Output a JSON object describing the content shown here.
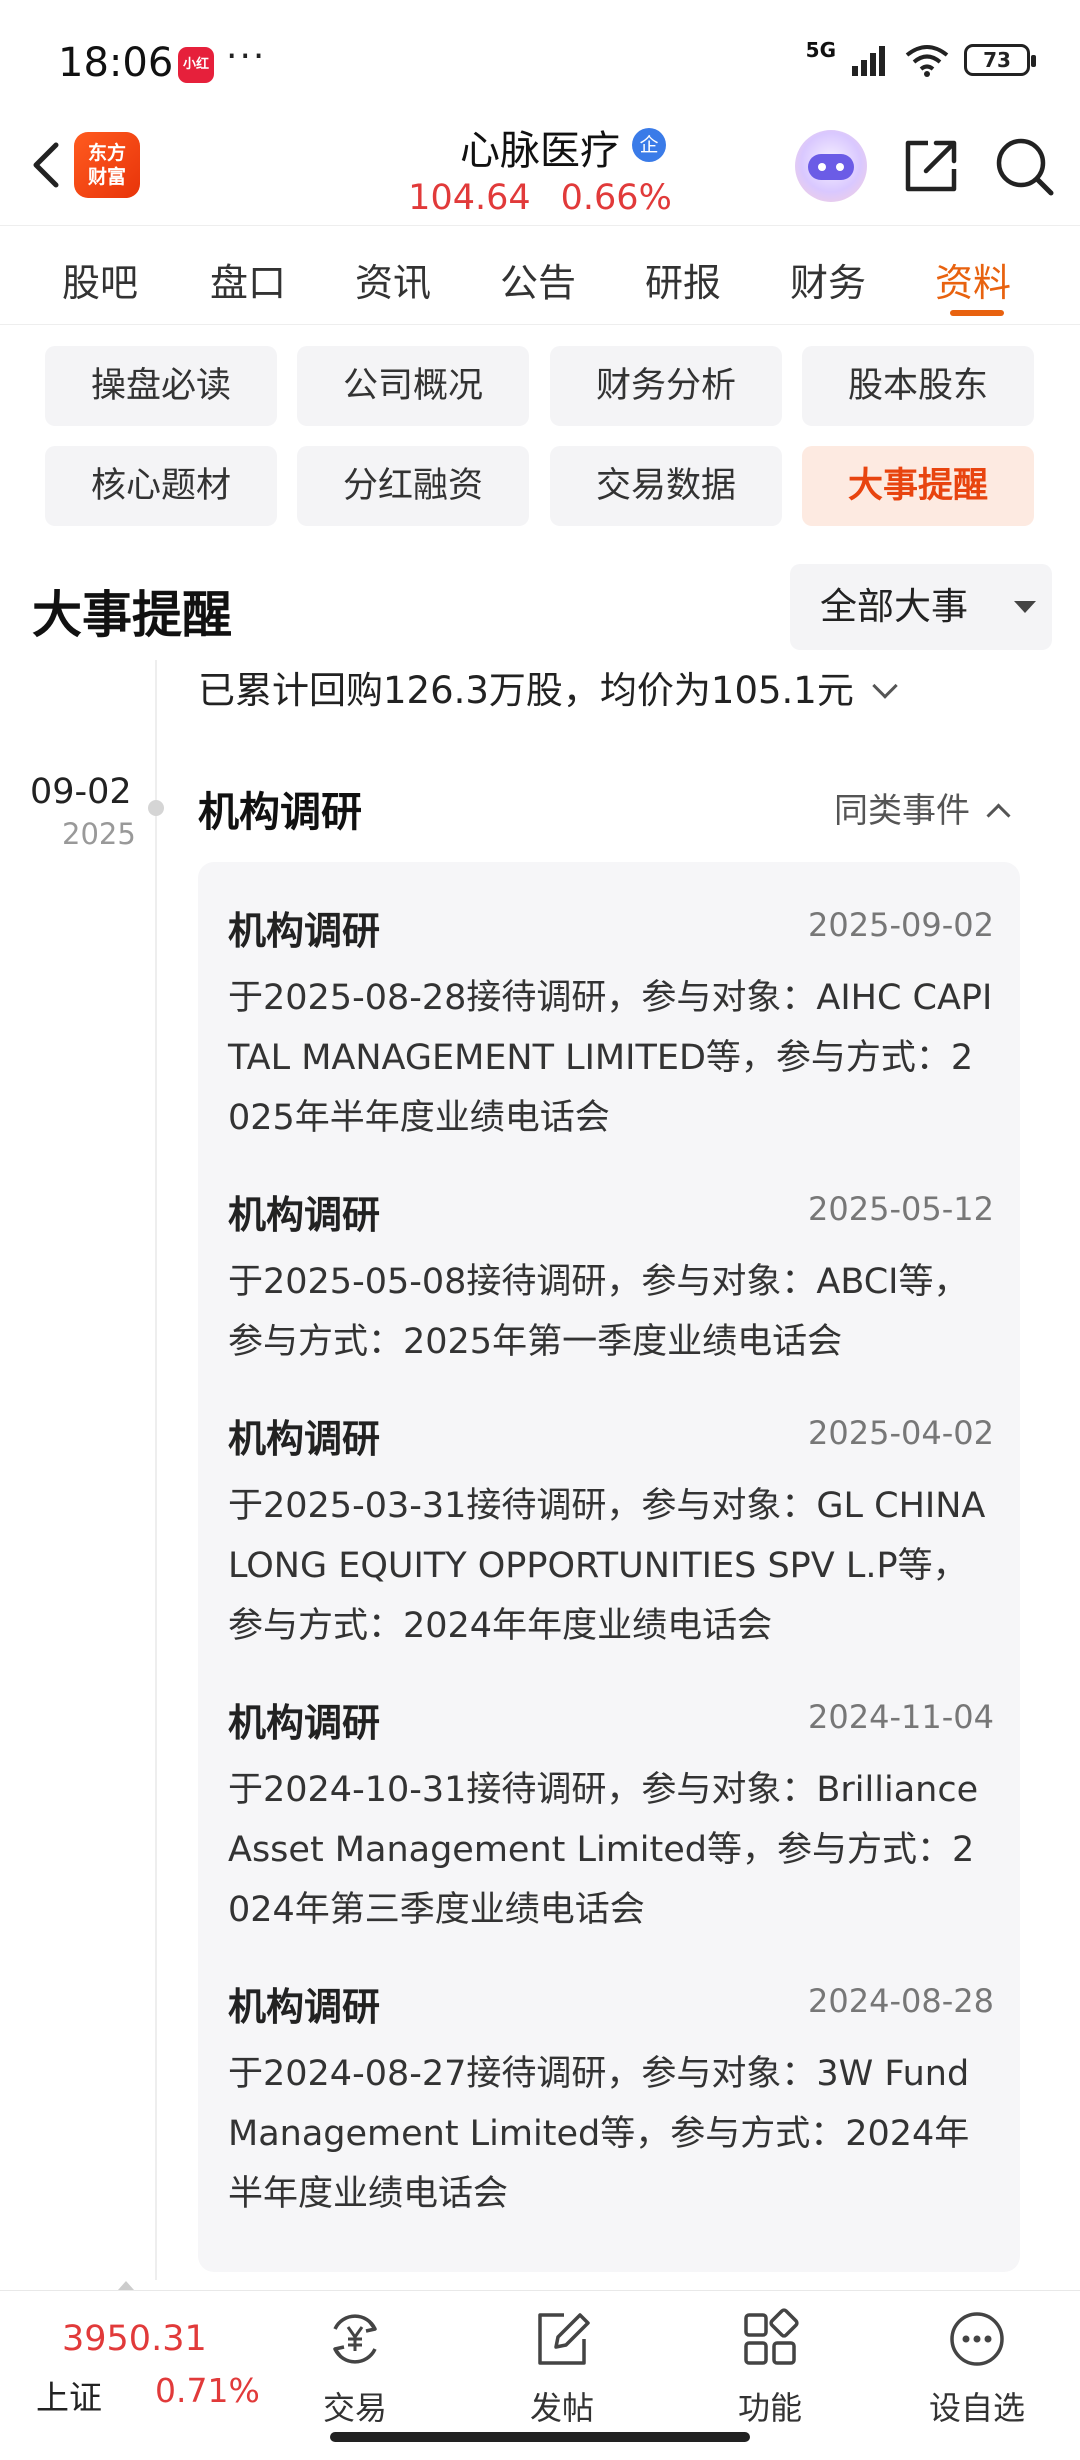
{
  "status_bar": {
    "time": "18:06",
    "app_badge": "小红书",
    "more": "···",
    "network": "5G",
    "battery": "73"
  },
  "header": {
    "logo_line1": "东方",
    "logo_line2": "财富",
    "stock_name": "心脉医疗",
    "badge": "企",
    "price": "104.64",
    "change_pct": "0.66%",
    "up_color": "#e13a3a"
  },
  "tabs": [
    {
      "label": "股吧"
    },
    {
      "label": "盘口"
    },
    {
      "label": "资讯"
    },
    {
      "label": "公告"
    },
    {
      "label": "研报"
    },
    {
      "label": "财务"
    },
    {
      "label": "资料",
      "active": true
    }
  ],
  "sub_tabs": [
    {
      "label": "操盘必读"
    },
    {
      "label": "公司概况"
    },
    {
      "label": "财务分析"
    },
    {
      "label": "股本股东"
    },
    {
      "label": "核心题材"
    },
    {
      "label": "分红融资"
    },
    {
      "label": "交易数据"
    },
    {
      "label": "大事提醒",
      "active": true
    }
  ],
  "section": {
    "title": "大事提醒",
    "filter": "全部大事"
  },
  "timeline": {
    "summary": "已累计回购126.3万股，均价为105.1元",
    "date_md": "09-02",
    "date_year": "2025",
    "event_title": "机构调研",
    "similar_label": "同类事件",
    "items": [
      {
        "title": "机构调研",
        "date": "2025-09-02",
        "desc": "于2025-08-28接待调研，参与对象：AIHC CAPITAL MANAGEMENT LIMITED等，参与方式：2025年半年度业绩电话会"
      },
      {
        "title": "机构调研",
        "date": "2025-05-12",
        "desc": "于2025-05-08接待调研，参与对象：ABCI等，参与方式：2025年第一季度业绩电话会"
      },
      {
        "title": "机构调研",
        "date": "2025-04-02",
        "desc": "于2025-03-31接待调研，参与对象：GL CHINA LONG EQUITY OPPORTUNITIES SPV L.P等，参与方式：2024年年度业绩电话会"
      },
      {
        "title": "机构调研",
        "date": "2024-11-04",
        "desc": "于2024-10-31接待调研，参与对象：Brilliance Asset Management Limited等，参与方式：2024年第三季度业绩电话会"
      },
      {
        "title": "机构调研",
        "date": "2024-08-28",
        "desc": "于2024-08-27接待调研，参与对象：3W Fund Management Limited等，参与方式：2024年半年度业绩电话会"
      }
    ]
  },
  "bottom_bar": {
    "index_value": "3950.31",
    "index_name": "上证",
    "index_change": "0.71%",
    "items": [
      {
        "label": "交易",
        "icon": "yuan-swap-icon"
      },
      {
        "label": "发帖",
        "icon": "edit-icon"
      },
      {
        "label": "功能",
        "icon": "grid-icon"
      },
      {
        "label": "设自选",
        "icon": "more-circle-icon"
      }
    ]
  }
}
